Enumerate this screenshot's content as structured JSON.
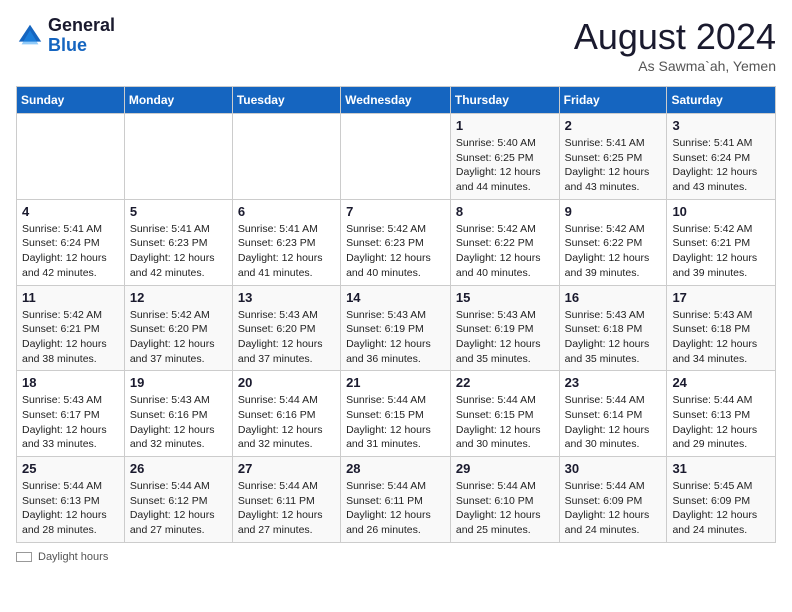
{
  "logo": {
    "line1": "General",
    "line2": "Blue"
  },
  "title": "August 2024",
  "location": "As Sawma`ah, Yemen",
  "days_of_week": [
    "Sunday",
    "Monday",
    "Tuesday",
    "Wednesday",
    "Thursday",
    "Friday",
    "Saturday"
  ],
  "weeks": [
    [
      {
        "num": "",
        "info": ""
      },
      {
        "num": "",
        "info": ""
      },
      {
        "num": "",
        "info": ""
      },
      {
        "num": "",
        "info": ""
      },
      {
        "num": "1",
        "info": "Sunrise: 5:40 AM\nSunset: 6:25 PM\nDaylight: 12 hours and 44 minutes."
      },
      {
        "num": "2",
        "info": "Sunrise: 5:41 AM\nSunset: 6:25 PM\nDaylight: 12 hours and 43 minutes."
      },
      {
        "num": "3",
        "info": "Sunrise: 5:41 AM\nSunset: 6:24 PM\nDaylight: 12 hours and 43 minutes."
      }
    ],
    [
      {
        "num": "4",
        "info": "Sunrise: 5:41 AM\nSunset: 6:24 PM\nDaylight: 12 hours and 42 minutes."
      },
      {
        "num": "5",
        "info": "Sunrise: 5:41 AM\nSunset: 6:23 PM\nDaylight: 12 hours and 42 minutes."
      },
      {
        "num": "6",
        "info": "Sunrise: 5:41 AM\nSunset: 6:23 PM\nDaylight: 12 hours and 41 minutes."
      },
      {
        "num": "7",
        "info": "Sunrise: 5:42 AM\nSunset: 6:23 PM\nDaylight: 12 hours and 40 minutes."
      },
      {
        "num": "8",
        "info": "Sunrise: 5:42 AM\nSunset: 6:22 PM\nDaylight: 12 hours and 40 minutes."
      },
      {
        "num": "9",
        "info": "Sunrise: 5:42 AM\nSunset: 6:22 PM\nDaylight: 12 hours and 39 minutes."
      },
      {
        "num": "10",
        "info": "Sunrise: 5:42 AM\nSunset: 6:21 PM\nDaylight: 12 hours and 39 minutes."
      }
    ],
    [
      {
        "num": "11",
        "info": "Sunrise: 5:42 AM\nSunset: 6:21 PM\nDaylight: 12 hours and 38 minutes."
      },
      {
        "num": "12",
        "info": "Sunrise: 5:42 AM\nSunset: 6:20 PM\nDaylight: 12 hours and 37 minutes."
      },
      {
        "num": "13",
        "info": "Sunrise: 5:43 AM\nSunset: 6:20 PM\nDaylight: 12 hours and 37 minutes."
      },
      {
        "num": "14",
        "info": "Sunrise: 5:43 AM\nSunset: 6:19 PM\nDaylight: 12 hours and 36 minutes."
      },
      {
        "num": "15",
        "info": "Sunrise: 5:43 AM\nSunset: 6:19 PM\nDaylight: 12 hours and 35 minutes."
      },
      {
        "num": "16",
        "info": "Sunrise: 5:43 AM\nSunset: 6:18 PM\nDaylight: 12 hours and 35 minutes."
      },
      {
        "num": "17",
        "info": "Sunrise: 5:43 AM\nSunset: 6:18 PM\nDaylight: 12 hours and 34 minutes."
      }
    ],
    [
      {
        "num": "18",
        "info": "Sunrise: 5:43 AM\nSunset: 6:17 PM\nDaylight: 12 hours and 33 minutes."
      },
      {
        "num": "19",
        "info": "Sunrise: 5:43 AM\nSunset: 6:16 PM\nDaylight: 12 hours and 32 minutes."
      },
      {
        "num": "20",
        "info": "Sunrise: 5:44 AM\nSunset: 6:16 PM\nDaylight: 12 hours and 32 minutes."
      },
      {
        "num": "21",
        "info": "Sunrise: 5:44 AM\nSunset: 6:15 PM\nDaylight: 12 hours and 31 minutes."
      },
      {
        "num": "22",
        "info": "Sunrise: 5:44 AM\nSunset: 6:15 PM\nDaylight: 12 hours and 30 minutes."
      },
      {
        "num": "23",
        "info": "Sunrise: 5:44 AM\nSunset: 6:14 PM\nDaylight: 12 hours and 30 minutes."
      },
      {
        "num": "24",
        "info": "Sunrise: 5:44 AM\nSunset: 6:13 PM\nDaylight: 12 hours and 29 minutes."
      }
    ],
    [
      {
        "num": "25",
        "info": "Sunrise: 5:44 AM\nSunset: 6:13 PM\nDaylight: 12 hours and 28 minutes."
      },
      {
        "num": "26",
        "info": "Sunrise: 5:44 AM\nSunset: 6:12 PM\nDaylight: 12 hours and 27 minutes."
      },
      {
        "num": "27",
        "info": "Sunrise: 5:44 AM\nSunset: 6:11 PM\nDaylight: 12 hours and 27 minutes."
      },
      {
        "num": "28",
        "info": "Sunrise: 5:44 AM\nSunset: 6:11 PM\nDaylight: 12 hours and 26 minutes."
      },
      {
        "num": "29",
        "info": "Sunrise: 5:44 AM\nSunset: 6:10 PM\nDaylight: 12 hours and 25 minutes."
      },
      {
        "num": "30",
        "info": "Sunrise: 5:44 AM\nSunset: 6:09 PM\nDaylight: 12 hours and 24 minutes."
      },
      {
        "num": "31",
        "info": "Sunrise: 5:45 AM\nSunset: 6:09 PM\nDaylight: 12 hours and 24 minutes."
      }
    ]
  ],
  "footer": {
    "legend_label": "Daylight hours"
  }
}
